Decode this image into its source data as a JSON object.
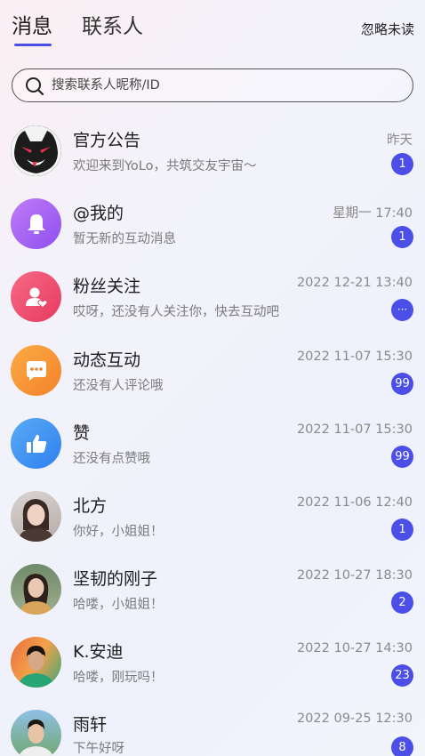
{
  "header": {
    "tab_messages": "消息",
    "tab_contacts": "联系人",
    "ignore_unread": "忽略未读"
  },
  "search": {
    "placeholder": "搜索联系人昵称/ID"
  },
  "conversations": [
    {
      "name": "官方公告",
      "preview": "欢迎来到YoLo，共筑交友宇宙～",
      "time": "昨天",
      "badge": "1"
    },
    {
      "name": "@我的",
      "preview": "暂无新的互动消息",
      "time": "星期一 17:40",
      "badge": "1"
    },
    {
      "name": "粉丝关注",
      "preview": "哎呀，还没有人关注你，快去互动吧",
      "time": "2022 12-21 13:40",
      "badge": "···"
    },
    {
      "name": "动态互动",
      "preview": "还没有人评论哦",
      "time": "2022 11-07 15:30",
      "badge": "99"
    },
    {
      "name": "赞",
      "preview": "还没有点赞哦",
      "time": "2022 11-07 15:30",
      "badge": "99"
    },
    {
      "name": "北方",
      "preview": "你好，小姐姐！",
      "time": "2022 11-06 12:40",
      "badge": "1"
    },
    {
      "name": "坚韧的刚子",
      "preview": "哈喽，小姐姐！",
      "time": "2022 10-27 18:30",
      "badge": "2"
    },
    {
      "name": "K.安迪",
      "preview": "哈喽，刚玩吗！",
      "time": "2022 10-27 14:30",
      "badge": "23"
    },
    {
      "name": "雨轩",
      "preview": "下午好呀",
      "time": "2022 09-25 12:30",
      "badge": "8"
    }
  ],
  "colors": {
    "accent": "#4b4fe8",
    "mention": "#a55df0",
    "fans": "#ee4b6f",
    "interaction": "#f6902f",
    "like": "#3d8ff3"
  },
  "icons": {
    "official": "cat-mascot-icon",
    "mention": "bell-icon",
    "fans": "user-heart-icon",
    "interaction": "chat-bubble-icon",
    "like": "thumbs-up-icon"
  }
}
